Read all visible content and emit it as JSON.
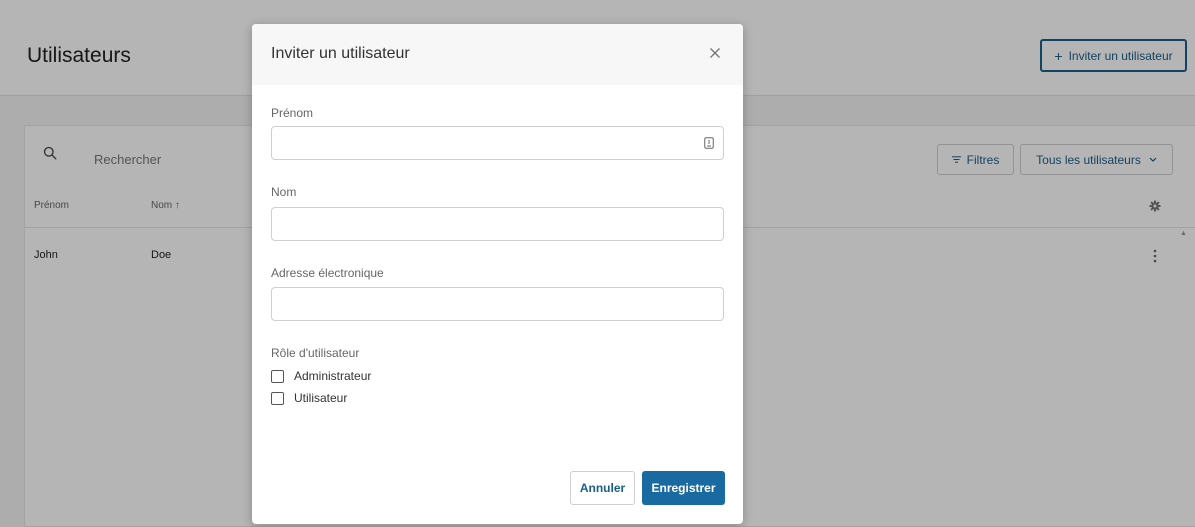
{
  "header": {
    "title": "Utilisateurs",
    "invite_button": {
      "icon": "plus-icon",
      "label": "Inviter un utilisateur"
    }
  },
  "toolbar": {
    "search_icon": "search-icon",
    "search_placeholder": "Rechercher",
    "filters_button": {
      "icon": "filter-icon",
      "label": "Filtres"
    },
    "scope_select": {
      "value": "Tous les utilisateurs",
      "icon": "chevron-down-icon"
    }
  },
  "table": {
    "columns": [
      {
        "label": "Prénom"
      },
      {
        "label": "Nom",
        "sort_icon": "arrow-up-icon",
        "sort_glyph": "↑"
      }
    ],
    "settings_icon": "gear-icon",
    "rows": [
      {
        "prenom": "John",
        "nom": "Doe",
        "menu_icon": "kebab-icon"
      }
    ]
  },
  "modal": {
    "title": "Inviter un utilisateur",
    "close_icon": "close-icon",
    "fields": [
      {
        "label": "Prénom",
        "value": "",
        "icon": "autofill-icon"
      },
      {
        "label": "Nom",
        "value": ""
      },
      {
        "label": "Adresse électronique",
        "value": ""
      }
    ],
    "role": {
      "label": "Rôle d'utilisateur",
      "options": [
        {
          "label": "Administrateur",
          "checked": false
        },
        {
          "label": "Utilisateur",
          "checked": false
        }
      ]
    },
    "cancel_label": "Annuler",
    "save_label": "Enregistrer"
  },
  "colors": {
    "accent": "#1a6aa2",
    "accent_border": "#1a5f8a",
    "overlay": "rgba(0,0,0,0.29)"
  }
}
